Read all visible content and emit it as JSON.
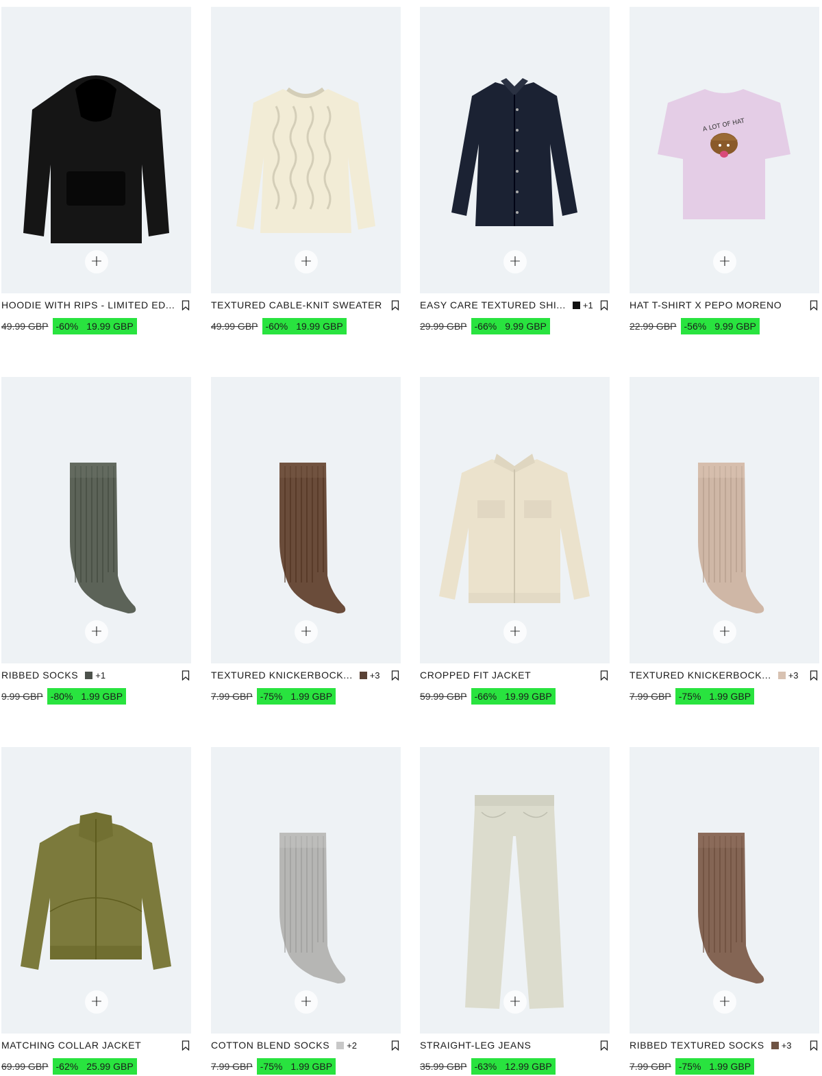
{
  "products": [
    {
      "name": "HOODIE WITH RIPS - LIMITED ED...",
      "old_price": "49.99 GBP",
      "discount": "-60%",
      "price": "19.99 GBP",
      "colors_extra": "",
      "swatch_color": "",
      "art": "hoodie",
      "art_color": "#151515"
    },
    {
      "name": "TEXTURED CABLE-KNIT SWEATER",
      "old_price": "49.99 GBP",
      "discount": "-60%",
      "price": "19.99 GBP",
      "colors_extra": "",
      "swatch_color": "",
      "art": "sweater",
      "art_color": "#f2ecd6"
    },
    {
      "name": "EASY CARE TEXTURED SHI...",
      "old_price": "29.99 GBP",
      "discount": "-66%",
      "price": "9.99 GBP",
      "colors_extra": "+1",
      "swatch_color": "#111111",
      "art": "shirt",
      "art_color": "#1b2233"
    },
    {
      "name": "HAT T-SHIRT X PEPO MORENO",
      "old_price": "22.99 GBP",
      "discount": "-56%",
      "price": "9.99 GBP",
      "colors_extra": "",
      "swatch_color": "",
      "art": "tshirt",
      "art_color": "#e4cde6",
      "art_text": "A LOT OF HAT"
    },
    {
      "name": "RIBBED SOCKS",
      "old_price": "9.99 GBP",
      "discount": "-80%",
      "price": "1.99 GBP",
      "colors_extra": "+1",
      "swatch_color": "#4d524c",
      "art": "sock",
      "art_color": "#5c6358"
    },
    {
      "name": "TEXTURED KNICKERBOCK...",
      "old_price": "7.99 GBP",
      "discount": "-75%",
      "price": "1.99 GBP",
      "colors_extra": "+3",
      "swatch_color": "#5a4236",
      "art": "sock",
      "art_color": "#6a4c3a"
    },
    {
      "name": "CROPPED FIT JACKET",
      "old_price": "59.99 GBP",
      "discount": "-66%",
      "price": "19.99 GBP",
      "colors_extra": "",
      "swatch_color": "",
      "art": "jacket",
      "art_color": "#ebe2cc"
    },
    {
      "name": "TEXTURED KNICKERBOCK...",
      "old_price": "7.99 GBP",
      "discount": "-75%",
      "price": "1.99 GBP",
      "colors_extra": "+3",
      "swatch_color": "#d8c2b2",
      "art": "sock",
      "art_color": "#cfb7a6"
    },
    {
      "name": "MATCHING COLLAR JACKET",
      "old_price": "69.99 GBP",
      "discount": "-62%",
      "price": "25.99 GBP",
      "colors_extra": "",
      "swatch_color": "",
      "art": "bomber",
      "art_color": "#7c7a3c"
    },
    {
      "name": "COTTON BLEND SOCKS",
      "old_price": "7.99 GBP",
      "discount": "-75%",
      "price": "1.99 GBP",
      "colors_extra": "+2",
      "swatch_color": "#c8c8c8",
      "art": "sock",
      "art_color": "#b6b6b4"
    },
    {
      "name": "STRAIGHT-LEG JEANS",
      "old_price": "35.99 GBP",
      "discount": "-63%",
      "price": "12.99 GBP",
      "colors_extra": "",
      "swatch_color": "",
      "art": "jeans",
      "art_color": "#dcdccd"
    },
    {
      "name": "RIBBED TEXTURED SOCKS",
      "old_price": "7.99 GBP",
      "discount": "-75%",
      "price": "1.99 GBP",
      "colors_extra": "+3",
      "swatch_color": "#6f5444",
      "art": "sock",
      "art_color": "#846554"
    }
  ],
  "add_symbol": "+",
  "colors": {
    "sale_highlight": "#29e33f",
    "image_bg": "#eef2f5"
  }
}
